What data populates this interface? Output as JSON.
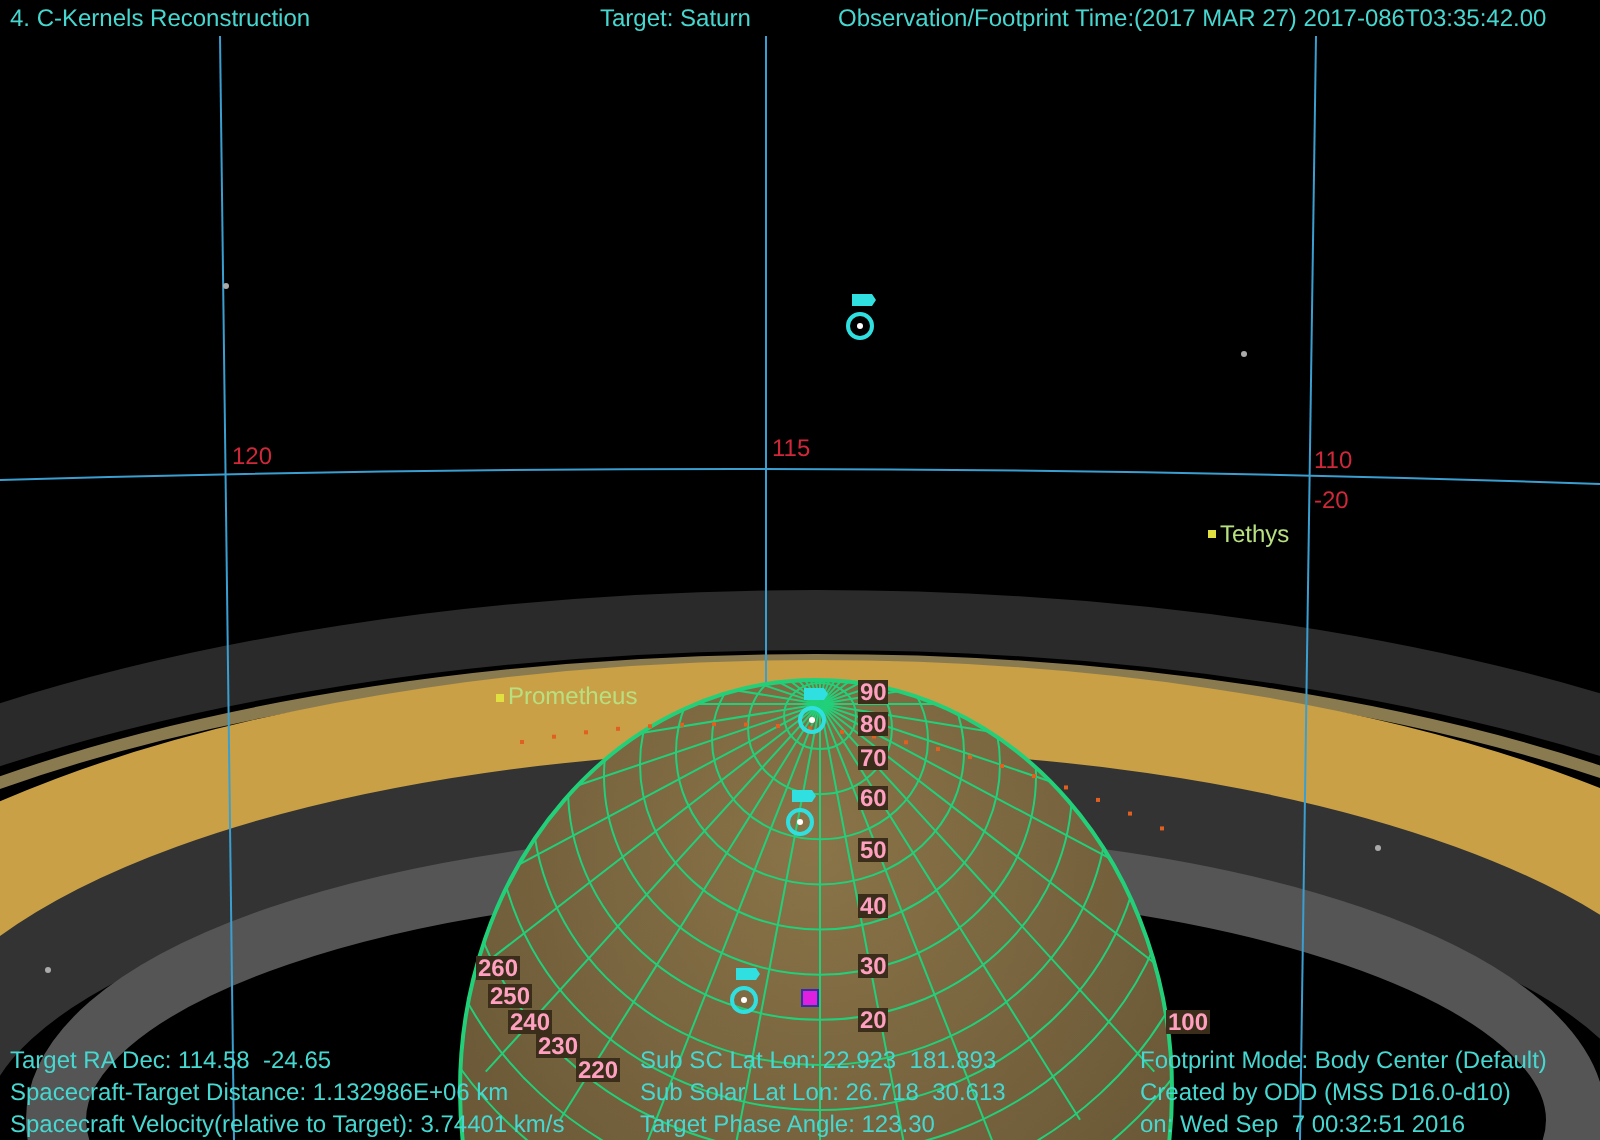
{
  "header": {
    "title": "4. C-Kernels Reconstruction",
    "target": "Target: Saturn",
    "time": "Observation/Footprint Time:(2017 MAR 27) 2017-086T03:35:42.00"
  },
  "sky_grid_labels": [
    "120",
    "115",
    "110",
    "-20"
  ],
  "moons": [
    {
      "name": "Prometheus"
    },
    {
      "name": "Tethys"
    }
  ],
  "latitude_labels": [
    "90",
    "80",
    "70",
    "60",
    "50",
    "40",
    "30",
    "20"
  ],
  "longitude_labels": [
    "260",
    "250",
    "240",
    "230",
    "220",
    "100"
  ],
  "info_left": [
    "Target RA Dec: 114.58  -24.65",
    "Spacecraft-Target Distance: 1.132986E+06 km",
    "Spacecraft Velocity(relative to Target): 3.74401 km/s"
  ],
  "info_middle": [
    "Sub SC Lat Lon: 22.923  181.893",
    "Sub Solar Lat Lon: 26.718  30.613",
    "Target Phase Angle: 123.30"
  ],
  "info_right": [
    "Footprint Mode: Body Center (Default)",
    "Created by ODD (MSS D16.0-d10)",
    "on: Wed Sep  7 00:32:51 2016"
  ]
}
